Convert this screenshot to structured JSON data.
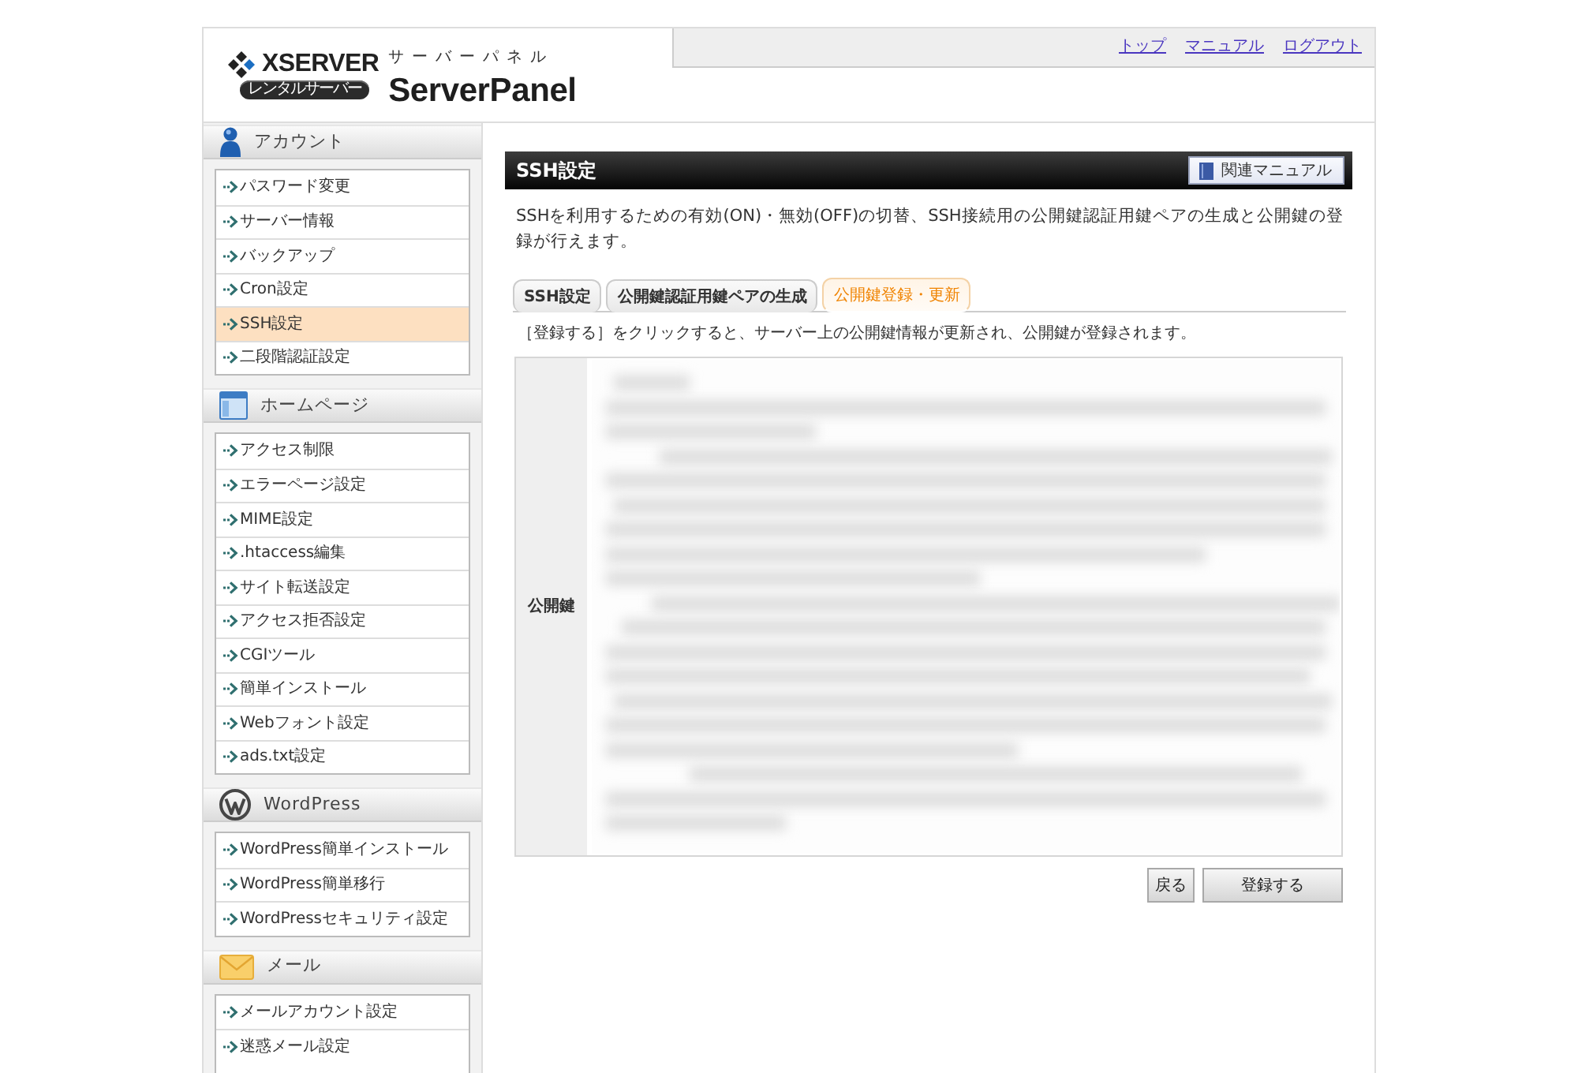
{
  "header": {
    "brand": "XSERVER",
    "tagline": "レンタルサーバー",
    "product_kana": "サーバーパネル",
    "product": "ServerPanel",
    "nav_links": [
      {
        "label": "トップ"
      },
      {
        "label": "マニュアル"
      },
      {
        "label": "ログアウト"
      }
    ]
  },
  "sidebar": {
    "sections": [
      {
        "title": "アカウント",
        "kind": "person",
        "items": [
          {
            "label": "パスワード変更",
            "selected": false
          },
          {
            "label": "サーバー情報",
            "selected": false
          },
          {
            "label": "バックアップ",
            "selected": false
          },
          {
            "label": "Cron設定",
            "selected": false
          },
          {
            "label": "SSH設定",
            "selected": true
          },
          {
            "label": "二段階認証設定",
            "selected": false
          }
        ]
      },
      {
        "title": "ホームページ",
        "kind": "window",
        "items": [
          {
            "label": "アクセス制限",
            "selected": false
          },
          {
            "label": "エラーページ設定",
            "selected": false
          },
          {
            "label": "MIME設定",
            "selected": false
          },
          {
            "label": ".htaccess編集",
            "selected": false
          },
          {
            "label": "サイト転送設定",
            "selected": false
          },
          {
            "label": "アクセス拒否設定",
            "selected": false
          },
          {
            "label": "CGIツール",
            "selected": false
          },
          {
            "label": "簡単インストール",
            "selected": false
          },
          {
            "label": "Webフォント設定",
            "selected": false
          },
          {
            "label": "ads.txt設定",
            "selected": false
          }
        ]
      },
      {
        "title": "WordPress",
        "kind": "wordpress",
        "items": [
          {
            "label": "WordPress簡単インストール",
            "selected": false
          },
          {
            "label": "WordPress簡単移行",
            "selected": false
          },
          {
            "label": "WordPressセキュリティ設定",
            "selected": false
          }
        ]
      },
      {
        "title": "メール",
        "kind": "mail",
        "items": [
          {
            "label": "メールアカウント設定",
            "selected": false
          },
          {
            "label": "迷惑メール設定",
            "selected": false
          }
        ]
      }
    ]
  },
  "main": {
    "title": "SSH設定",
    "manual_button": "関連マニュアル",
    "description": "SSHを利用するための有効(ON)・無効(OFF)の切替、SSH接続用の公開鍵認証用鍵ペアの生成と公開鍵の登録が行えます。",
    "tabs": [
      {
        "label": "SSH設定",
        "selected": false
      },
      {
        "label": "公開鍵認証用鍵ペアの生成",
        "selected": false
      },
      {
        "label": "公開鍵登録・更新",
        "selected": true
      }
    ],
    "instruction": "［登録する］をクリックすると、サーバー上の公開鍵情報が更新され、公開鍵が登録されます。",
    "form": {
      "label": "公開鍵"
    },
    "buttons": [
      {
        "label": "戻る",
        "kind": "back"
      },
      {
        "label": "登録する",
        "kind": "submit"
      }
    ]
  }
}
